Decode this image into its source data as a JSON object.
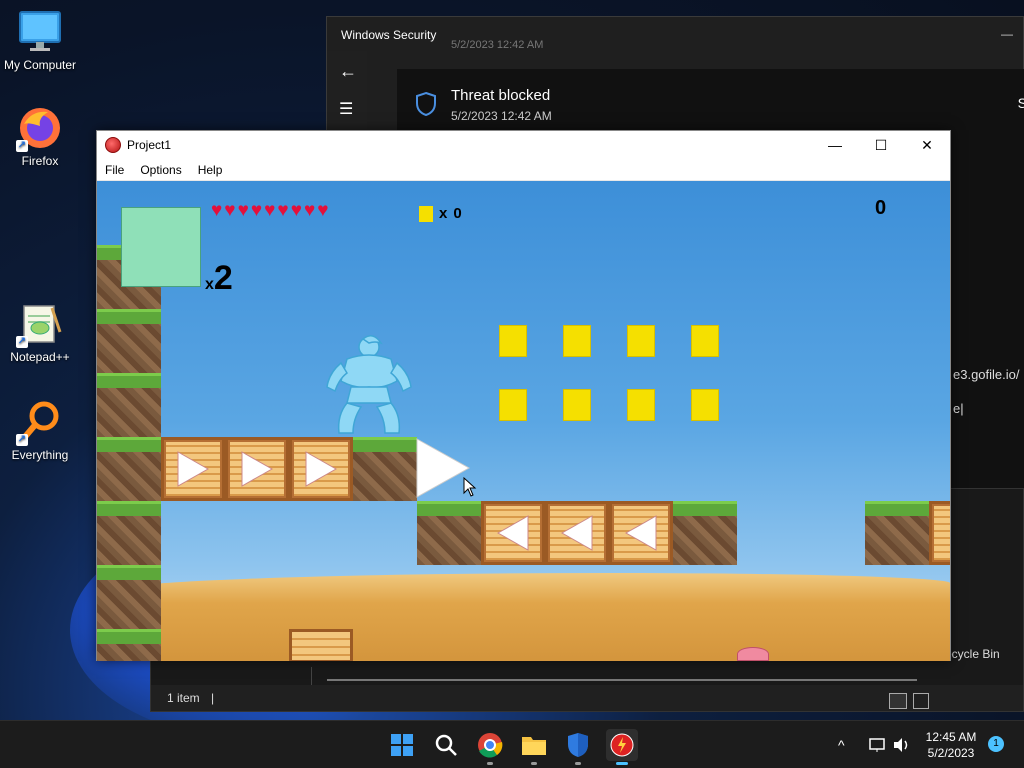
{
  "desktop": {
    "icons": [
      {
        "label": "My Computer",
        "icon": "monitor-icon"
      },
      {
        "label": "Firefox",
        "icon": "firefox-icon"
      },
      {
        "label": "Notepad++",
        "icon": "notepadpp-icon"
      },
      {
        "label": "Everything",
        "icon": "everything-search-icon"
      }
    ]
  },
  "windows_security": {
    "title": "Windows Security",
    "faded_timestamp": "5/2/2023 12:42 AM",
    "notice_title": "Threat blocked",
    "notice_time": "5/2/2023 12:42 AM",
    "right_edge_letter": "S",
    "minimize_glyph": "—"
  },
  "explorer_behind": {
    "partial_url": "e3.gofile.io/",
    "partial_text": "e|",
    "recycle_bin_label": "ecycle Bin",
    "status_items": "1 item",
    "status_divider": "|"
  },
  "game_window": {
    "title": "Project1",
    "menu": [
      "File",
      "Options",
      "Help"
    ],
    "controls": {
      "minimize": "—",
      "maximize": "☐",
      "close": "✕"
    },
    "hud": {
      "hearts": 9,
      "heart_glyph": "♥",
      "coin_prefix": "x",
      "coin_count": "0",
      "lives_prefix": "x",
      "lives_count": "2",
      "score": "0"
    },
    "colors": {
      "coin": "#f5e000",
      "heart": "#e3103b",
      "portrait": "#8fe0b8",
      "sky_top": "#3d8fd8"
    }
  },
  "taskbar": {
    "apps": [
      "start-icon",
      "search-icon",
      "chrome-icon",
      "file-explorer-icon",
      "windows-security-icon",
      "project1-icon"
    ],
    "time": "12:45 AM",
    "date": "5/2/2023",
    "notification_count": "1",
    "chevron": "^"
  }
}
